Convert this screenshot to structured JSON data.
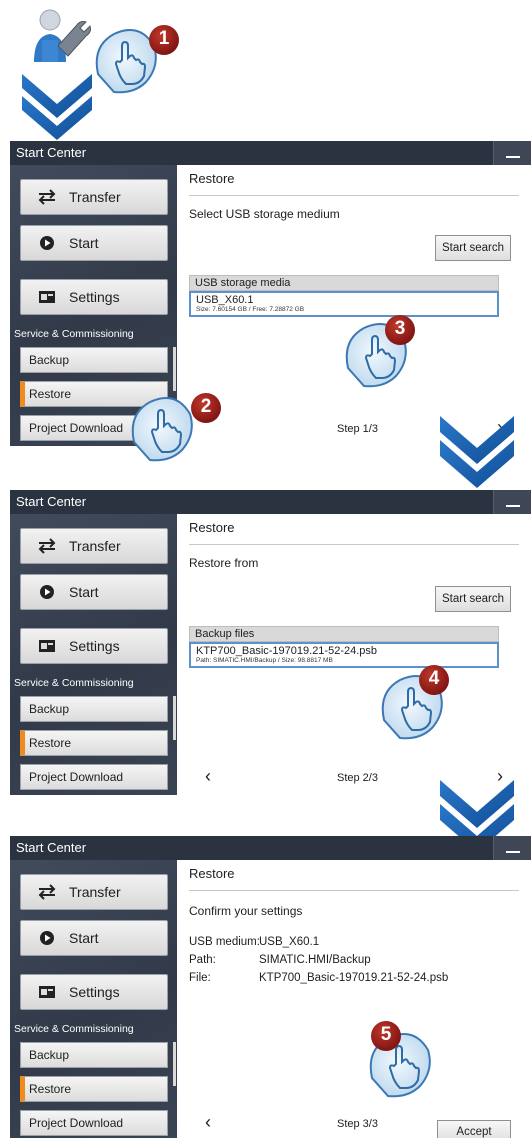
{
  "colors": {
    "titlebar": "#2b3340",
    "accent_orange": "#f08a1c",
    "selection_border": "#5d92c8",
    "arrow_blue": "#1a5aa8",
    "badge_red": "#8e1b1b"
  },
  "icons": [
    "user-settings-icon",
    "transfer-arrows-icon",
    "play-circle-icon",
    "settings-panel-icon",
    "touch-hand-icon",
    "chevron-left-icon",
    "chevron-right-icon",
    "double-chevron-down-icon"
  ],
  "steps": [
    {
      "badge": "1"
    },
    {
      "badge": "2"
    },
    {
      "badge": "3"
    },
    {
      "badge": "4"
    },
    {
      "badge": "5"
    }
  ],
  "screens": [
    {
      "window_title": "Start Center",
      "sidebar": {
        "transfer": "Transfer",
        "start": "Start",
        "settings": "Settings",
        "section": "Service & Commissioning",
        "items": [
          "Backup",
          "Restore",
          "Project Download"
        ]
      },
      "content": {
        "title": "Restore",
        "subtitle": "Select USB storage medium",
        "search_button": "Start search",
        "list_header": "USB storage media",
        "list_item_main": "USB_X60.1",
        "list_item_detail": "Size: 7.60154 GB / Free: 7.28872 GB",
        "step": "Step 1/3"
      }
    },
    {
      "window_title": "Start Center",
      "sidebar": {
        "transfer": "Transfer",
        "start": "Start",
        "settings": "Settings",
        "section": "Service & Commissioning",
        "items": [
          "Backup",
          "Restore",
          "Project Download"
        ]
      },
      "content": {
        "title": "Restore",
        "subtitle": "Restore from",
        "search_button": "Start search",
        "list_header": "Backup files",
        "list_item_main": "KTP700_Basic-197019.21-52-24.psb",
        "list_item_detail": "Path: SIMATIC.HMI/Backup / Size: 98.8817 MB",
        "step": "Step 2/3"
      }
    },
    {
      "window_title": "Start Center",
      "sidebar": {
        "transfer": "Transfer",
        "start": "Start",
        "settings": "Settings",
        "section": "Service & Commissioning",
        "items": [
          "Backup",
          "Restore",
          "Project Download"
        ]
      },
      "content": {
        "title": "Restore",
        "subtitle": "Confirm your settings",
        "usb_label": "USB medium:",
        "usb_value": "USB_X60.1",
        "path_label": "Path:",
        "path_value": "SIMATIC.HMI/Backup",
        "file_label": "File:",
        "file_value": "KTP700_Basic-197019.21-52-24.psb",
        "accept_button": "Accept",
        "step": "Step 3/3"
      }
    }
  ]
}
